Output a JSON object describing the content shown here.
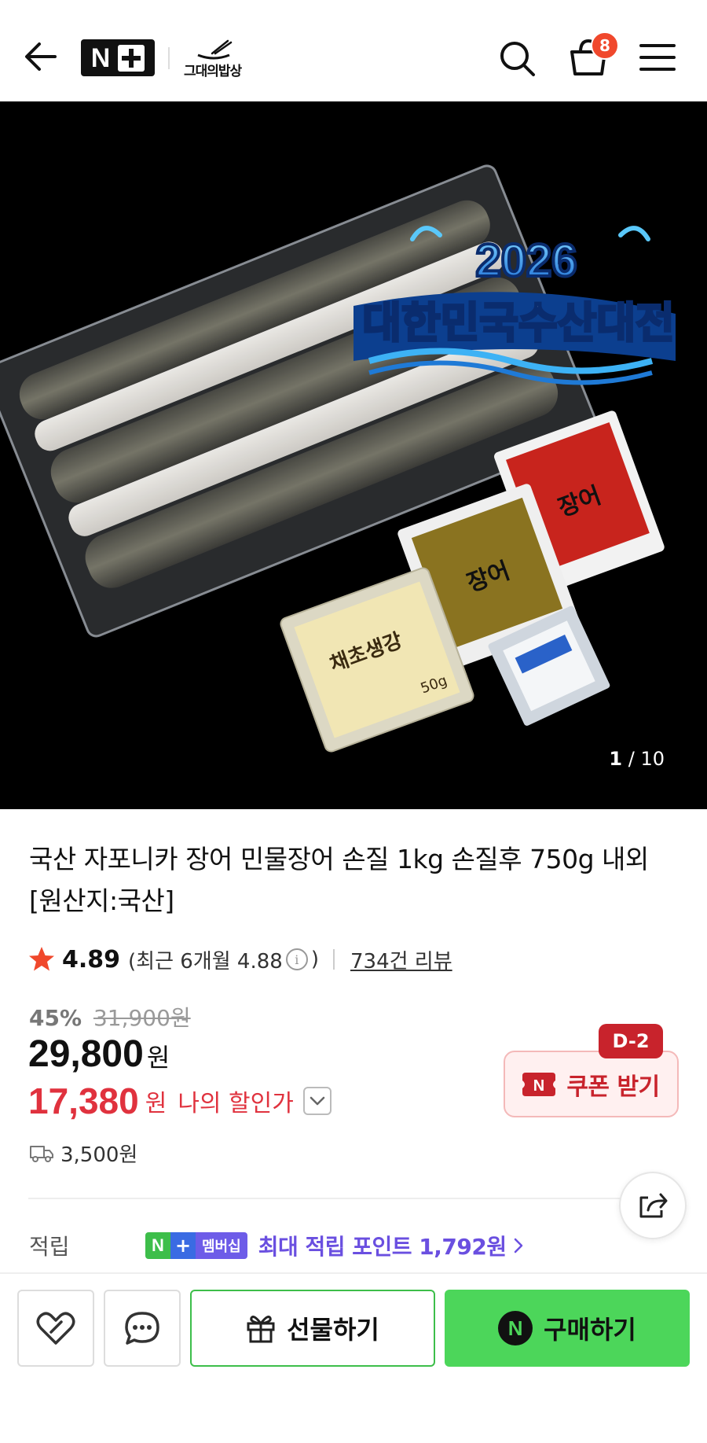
{
  "header": {
    "brand_mark": "N+",
    "store_name": "그대의밥상",
    "cart_count": "8"
  },
  "product_image": {
    "banner_year": "2026",
    "banner_title": "대한민국수산대전",
    "counter_current": "1",
    "counter_total": "10",
    "counter_sep": "/"
  },
  "product": {
    "title": "국산 자포니카 장어 민물장어 손질 1kg 손질후 750g 내외 [원산지:국산]",
    "rating": "4.89",
    "recent_rating_open": "(최근 6개월 4.88",
    "recent_rating_close": ")",
    "review_count": "734건 리뷰",
    "discount_pct": "45%",
    "original_price": "31,900원",
    "sale_price": "29,800",
    "sale_price_unit": "원",
    "my_price": "17,380",
    "my_price_unit": "원",
    "my_price_label": "나의 할인가",
    "shipping_fee": "3,500원"
  },
  "coupon": {
    "label": "쿠폰 받기",
    "dday": "D-2",
    "icon_letter": "N"
  },
  "points": {
    "label": "적립",
    "badge_n": "N",
    "badge_plus": "+",
    "badge_text": "멤버십",
    "text": "최대 적립 포인트 1,792원"
  },
  "bottom_bar": {
    "gift_label": "선물하기",
    "buy_label": "구매하기",
    "buy_icon_letter": "N"
  },
  "colors": {
    "accent_red": "#e0323e",
    "coupon_red": "#c8232c",
    "naver_green": "#4cd65a",
    "membership_purple": "#6a4fe0"
  }
}
